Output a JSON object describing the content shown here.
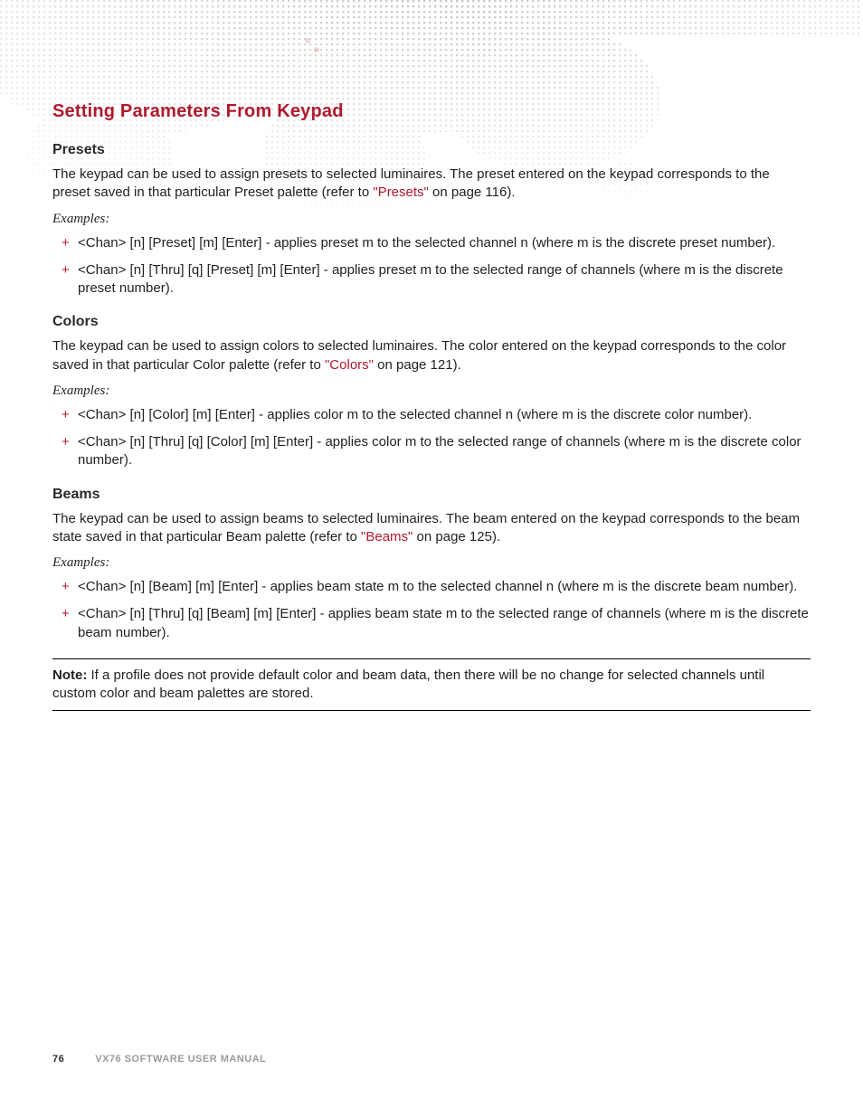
{
  "page": {
    "main_heading": "Setting Parameters From Keypad",
    "sections": [
      {
        "title": "Presets",
        "intro_pre": "The keypad can be used to assign presets to selected luminaires. The preset entered on the keypad corresponds to the preset saved in that particular Preset palette (refer to ",
        "link_text": "\"Presets\"",
        "intro_post": " on page 116).",
        "examples_label": "Examples:",
        "items": [
          "<Chan> [n] [Preset] [m] [Enter] - applies preset m to the selected channel n (where m is the discrete preset number).",
          "<Chan> [n] [Thru] [q] [Preset] [m] [Enter] - applies preset m to the selected range of channels (where m is the discrete preset number)."
        ]
      },
      {
        "title": "Colors",
        "intro_pre": "The keypad can be used to assign colors to selected luminaires. The color entered on the keypad corresponds to the color saved in that particular Color palette (refer to ",
        "link_text": "\"Colors\"",
        "intro_post": " on page 121).",
        "examples_label": "Examples:",
        "items": [
          "<Chan> [n] [Color] [m] [Enter] - applies color m to the selected channel n (where m is the discrete color number).",
          "<Chan> [n] [Thru] [q] [Color] [m] [Enter] - applies color m to the selected range of channels (where m is the discrete color number)."
        ]
      },
      {
        "title": "Beams",
        "intro_pre": "The keypad can be used to assign beams to selected luminaires. The beam entered on the keypad corresponds to the beam state saved in that particular Beam palette (refer to ",
        "link_text": "\"Beams\"",
        "intro_post": " on page 125).",
        "examples_label": "Examples:",
        "items": [
          "<Chan> [n] [Beam] [m] [Enter] - applies beam state m to the selected channel n (where m is the discrete beam number).",
          "<Chan> [n] [Thru] [q] [Beam] [m] [Enter] - applies beam state m to the selected range of channels (where m is the discrete beam number)."
        ]
      }
    ],
    "note": {
      "label": "Note:",
      "text": "  If a profile does not provide default color and beam data, then there will be no change for selected channels until custom color and beam palettes are stored."
    },
    "footer": {
      "page_number": "76",
      "manual_title": "VX76 SOFTWARE USER MANUAL"
    }
  }
}
